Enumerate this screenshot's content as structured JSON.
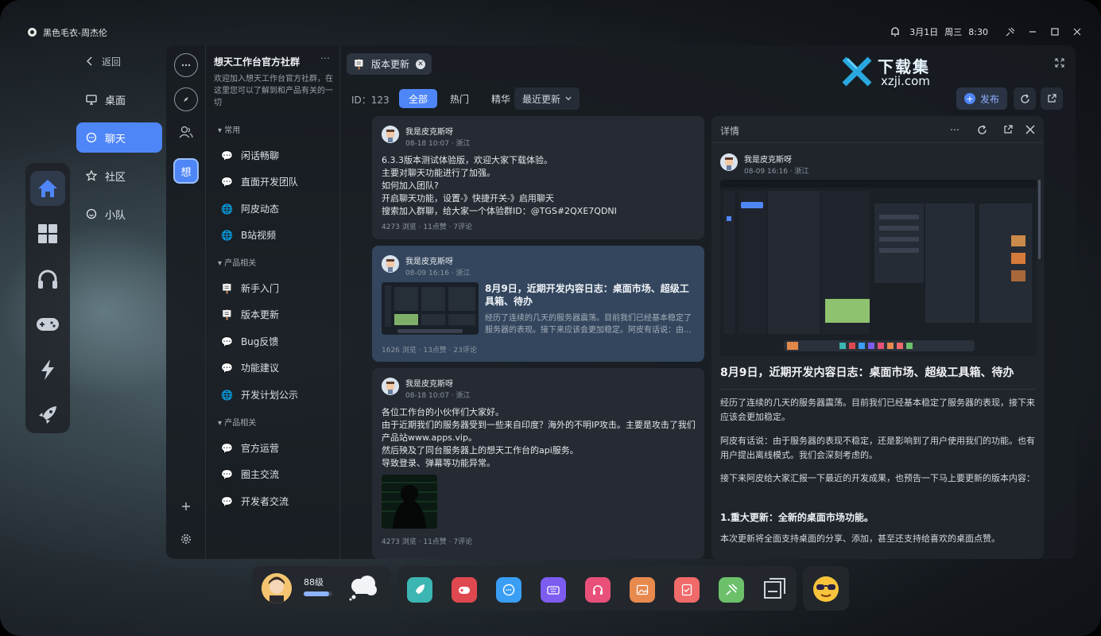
{
  "window": {
    "title": "黑色毛衣-周杰伦",
    "date": "3月1日",
    "weekday": "周三",
    "time": "8:30"
  },
  "nav": {
    "back": "返回",
    "items": [
      {
        "label": "桌面"
      },
      {
        "label": "聊天",
        "active": true
      },
      {
        "label": "社区"
      },
      {
        "label": "小队"
      }
    ]
  },
  "rail": {
    "active_label": "想"
  },
  "channel": {
    "title": "想天工作台官方社群",
    "description": "欢迎加入想天工作台官方社群，在这里您可以了解到和产品有关的一切",
    "groups": [
      {
        "label": "常用",
        "items": [
          "闲话畅聊",
          "直面开发团队",
          "阿皮动态",
          "B站视频"
        ]
      },
      {
        "label": "产品相关",
        "items": [
          "新手入门",
          "版本更新",
          "Bug反馈",
          "功能建议",
          "开发计划公示"
        ]
      },
      {
        "label": "产品相关",
        "items": [
          "官方运营",
          "圈主交流",
          "开发者交流"
        ]
      }
    ]
  },
  "tab": {
    "label": "版本更新"
  },
  "toolbar": {
    "id": "ID：123",
    "filters": [
      "全部",
      "热门",
      "精华"
    ],
    "sort": "最近更新",
    "publish": "发布"
  },
  "feed": [
    {
      "user": "我是皮克斯呀",
      "meta": "08-18 10:07 · 浙江",
      "text": "6.3.3版本测试体验版，欢迎大家下载体验。\n主要对聊天功能进行了加强。\n如何加入团队?\n开启聊天功能，设置-》快捷开关-》启用聊天\n搜索加入群聊，给大家一个体验群ID：@TGS#2QXE7QDNI",
      "stats": "4273 浏览 · 11点赞 · 7评论"
    },
    {
      "user": "我是皮克斯呀",
      "meta": "08-09 16:16 · 浙江",
      "title": "8月9日，近期开发内容日志：桌面市场、超级工具箱、待办",
      "excerpt": "经历了连续的几天的服务器震荡。目前我们已经基本稳定了服务器的表现。接下来应该会更加稳定。阿皮有话说：由...",
      "stats": "1626 浏览 · 13点赞 · 23评论"
    },
    {
      "user": "我是皮克斯呀",
      "meta": "08-18 10:07 · 浙江",
      "text": "各位工作台的小伙伴们大家好。\n由于近期我们的服务器受到一些来自印度？海外的不明IP攻击。主要是攻击了我们产品站www.apps.vip。\n然后殃及了同台服务器上的想天工作台的api服务。\n导致登录、弹幕等功能异常。",
      "stats": "4273 浏览 · 11点赞 · 7评论"
    }
  ],
  "detail": {
    "header": "详情",
    "user": "我是皮克斯呀",
    "meta": "08-09 16:16 · 浙江",
    "title": "8月9日，近期开发内容日志：桌面市场、超级工具箱、待办",
    "paragraphs": [
      "经历了连续的几天的服务器震荡。目前我们已经基本稳定了服务器的表现，接下来应该会更加稳定。",
      "阿皮有话说：由于服务器的表现不稳定，还是影响到了用户使用我们的功能。也有用户提出离线模式。我们会深刻考虑的。",
      "接下来阿皮给大家汇报一下最近的开发成果，也预告一下马上要更新的版本内容："
    ],
    "subheading": "1.重大更新：全新的桌面市场功能。",
    "last": "本次更新将全面支持桌面的分享、添加，甚至还支持给喜欢的桌面点赞。"
  },
  "watermark": {
    "cn": "下载集",
    "url": "xzji.com"
  },
  "bottom": {
    "level": "88级",
    "level_progress": 0.9,
    "apps": [
      {
        "icon": "rocket-icon",
        "color": "#3cb6b2"
      },
      {
        "icon": "gamepad-icon",
        "color": "#e0484f"
      },
      {
        "icon": "chat-icon",
        "color": "#3a9ef5"
      },
      {
        "icon": "keyboard-icon",
        "color": "#7d5cf0"
      },
      {
        "icon": "headphones-icon",
        "color": "#e8507a"
      },
      {
        "icon": "image-icon",
        "color": "#e8894d"
      },
      {
        "icon": "check-icon",
        "color": "#f06a6a"
      },
      {
        "icon": "pin-icon",
        "color": "#6cc06a"
      }
    ]
  }
}
